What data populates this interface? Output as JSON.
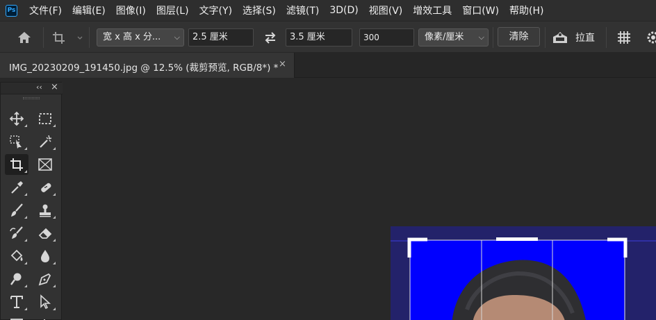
{
  "app": {
    "logo_text": "Ps"
  },
  "menu": [
    "文件(F)",
    "编辑(E)",
    "图像(I)",
    "图层(L)",
    "文字(Y)",
    "选择(S)",
    "滤镜(T)",
    "3D(D)",
    "视图(V)",
    "增效工具",
    "窗口(W)",
    "帮助(H)"
  ],
  "options": {
    "ratio_select": "宽 x 高 x 分...",
    "width_value": "2.5 厘米",
    "height_value": "3.5 厘米",
    "resolution_value": "300",
    "unit_select": "像素/厘米",
    "clear_label": "清除",
    "straighten_label": "拉直"
  },
  "document_tab": {
    "title": "IMG_20230209_191450.jpg @ 12.5% (裁剪预览, RGB/8*) *",
    "close_symbol": "×"
  },
  "toolbox": {
    "collapse_symbol": "‹‹",
    "close_symbol": "×",
    "tools": [
      "move-tool",
      "marquee-tool",
      "object-selection-tool",
      "magic-wand-tool",
      "crop-tool",
      "frame-tool",
      "eyedropper-tool",
      "healing-brush-tool",
      "brush-tool",
      "clone-stamp-tool",
      "history-brush-tool",
      "eraser-tool",
      "paint-bucket-tool",
      "blur-tool",
      "dodge-tool",
      "pen-tool",
      "type-tool",
      "path-selection-tool"
    ],
    "active_tool": "crop-tool"
  },
  "colors": {
    "photo_background": "#0000ff",
    "document_padding": "#23226a",
    "canvas_background": "#282828"
  }
}
